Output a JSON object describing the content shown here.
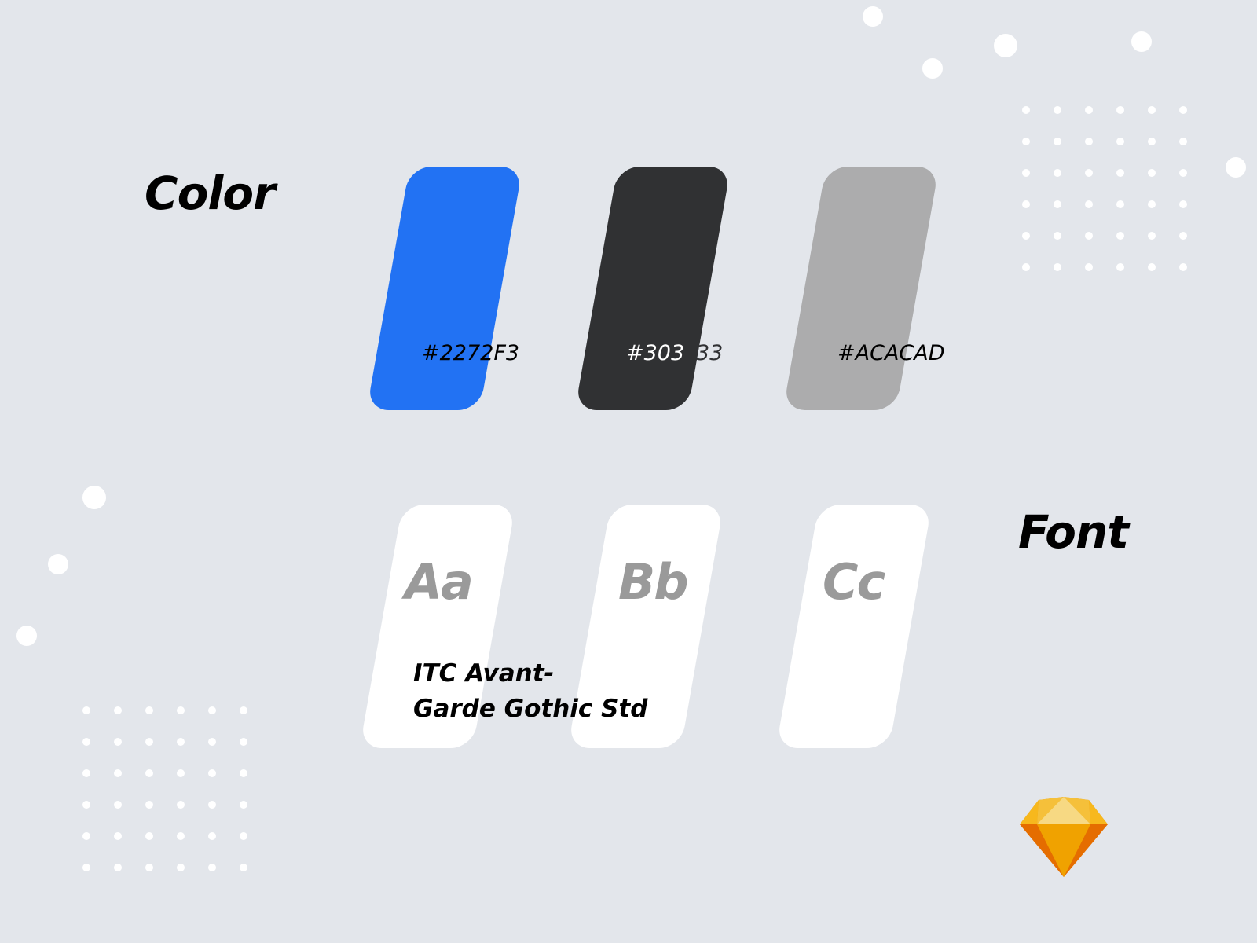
{
  "sections": {
    "color_title": "Color",
    "font_title": "Font"
  },
  "colors": [
    {
      "hex_label": "#2272F3",
      "value": "#2272F3",
      "label_color": "#000000"
    },
    {
      "hex_label": "#303",
      "hex_label_tail": "33",
      "value": "#303133",
      "label_color": "#ffffff",
      "tail_color": "#303133"
    },
    {
      "hex_label": "#ACACAD",
      "value": "#ACACAD",
      "label_color": "#000000"
    }
  ],
  "font": {
    "samples": [
      "Aa",
      "Bb",
      "Cc"
    ],
    "name_lines": [
      "ITC Avant-",
      "Garde Gothic Std"
    ]
  },
  "logo": {
    "icon": "sketch-diamond-icon",
    "colors": {
      "top": "#FDB300",
      "mid": "#EA6C00",
      "light": "#FDAD00",
      "dark": "#FEEEB7"
    }
  },
  "background": "#e3e6eb"
}
